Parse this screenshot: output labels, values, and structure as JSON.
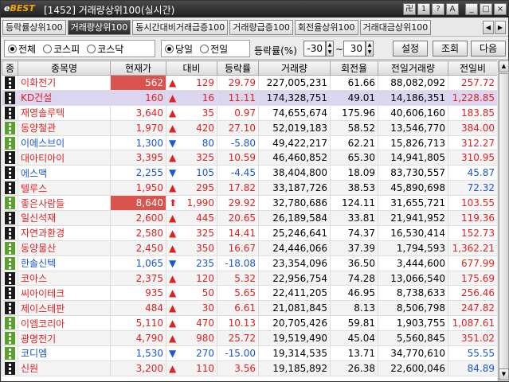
{
  "window": {
    "logo_prefix": "e",
    "logo_text": "BEST",
    "title": "[1452] 거래량상위100(실시간)",
    "title_buttons": [
      "卍",
      "1",
      "?",
      "A",
      "_",
      "□",
      "×"
    ]
  },
  "tabs": [
    {
      "label": "등락률상위100",
      "active": false
    },
    {
      "label": "거래량상위100",
      "active": true
    },
    {
      "label": "동시간대비거래급증100",
      "active": false
    },
    {
      "label": "거래량급증100",
      "active": false
    },
    {
      "label": "회전율상위100",
      "active": false
    },
    {
      "label": "거래대금상위100",
      "active": false
    }
  ],
  "filters": {
    "market": [
      {
        "label": "전체",
        "checked": true
      },
      {
        "label": "코스피",
        "checked": false
      },
      {
        "label": "코스닥",
        "checked": false
      }
    ],
    "day": [
      {
        "label": "당일",
        "checked": true
      },
      {
        "label": "전일",
        "checked": false
      }
    ],
    "range_label": "등락률(%)",
    "range_from": "-30",
    "range_sep": "~",
    "range_to": "30"
  },
  "buttons": {
    "settings": "설정",
    "query": "조회",
    "next": "다음"
  },
  "columns": [
    "종",
    "종목명",
    "현재가",
    "대비",
    "등락률",
    "거래량",
    "회전율",
    "전일거래량",
    "전일비"
  ],
  "colors": {
    "up": "#e02020",
    "down": "#1a56d6",
    "highlight": "#d9534f",
    "selected": "#dcd5f0",
    "badge_black": "#1a1a1a",
    "badge_green": "#5aa02c"
  },
  "rows": [
    {
      "badge": "black",
      "name": "이화전기",
      "price": "562",
      "dir": "up",
      "change": "129",
      "rate": "29.79",
      "volume": "227,005,231",
      "turnover": "61.66",
      "prev_volume": "88,082,092",
      "prev_ratio": "257.72",
      "price_hl": true
    },
    {
      "badge": "black",
      "name": "KD건설",
      "price": "160",
      "dir": "up",
      "change": "16",
      "rate": "11.11",
      "volume": "174,328,751",
      "turnover": "49.01",
      "prev_volume": "14,186,351",
      "prev_ratio": "1,228.85",
      "selected": true
    },
    {
      "badge": "black",
      "name": "재영솔루텍",
      "price": "3,640",
      "dir": "up",
      "change": "35",
      "rate": "0.97",
      "volume": "74,655,674",
      "turnover": "175.96",
      "prev_volume": "40,606,160",
      "prev_ratio": "183.85"
    },
    {
      "badge": "green",
      "name": "동양철관",
      "price": "1,970",
      "dir": "up",
      "change": "420",
      "rate": "27.10",
      "volume": "52,019,183",
      "turnover": "58.52",
      "prev_volume": "13,546,770",
      "prev_ratio": "384.00"
    },
    {
      "badge": "green",
      "name": "이에스브이",
      "price": "1,300",
      "dir": "down",
      "change": "80",
      "rate": "-5.80",
      "volume": "49,422,217",
      "turnover": "62.21",
      "prev_volume": "15,826,713",
      "prev_ratio": "312.27"
    },
    {
      "badge": "black",
      "name": "대아티아이",
      "price": "3,395",
      "dir": "up",
      "change": "325",
      "rate": "10.59",
      "volume": "46,460,852",
      "turnover": "65.30",
      "prev_volume": "14,941,805",
      "prev_ratio": "310.95"
    },
    {
      "badge": "black",
      "name": "에스맥",
      "price": "2,255",
      "dir": "down",
      "change": "105",
      "rate": "-4.45",
      "volume": "38,404,800",
      "turnover": "18.09",
      "prev_volume": "83,730,557",
      "prev_ratio": "45.87"
    },
    {
      "badge": "black",
      "name": "텔루스",
      "price": "1,950",
      "dir": "up",
      "change": "295",
      "rate": "17.82",
      "volume": "33,187,726",
      "turnover": "38.53",
      "prev_volume": "45,890,698",
      "prev_ratio": "72.32"
    },
    {
      "badge": "green",
      "name": "좋은사람들",
      "price": "8,640",
      "dir": "upup",
      "change": "1,990",
      "rate": "29.92",
      "volume": "32,780,686",
      "turnover": "124.11",
      "prev_volume": "31,655,721",
      "prev_ratio": "103.55",
      "price_hl": true
    },
    {
      "badge": "black",
      "name": "일신석재",
      "price": "2,600",
      "dir": "up",
      "change": "445",
      "rate": "20.65",
      "volume": "26,189,584",
      "turnover": "33.81",
      "prev_volume": "21,941,952",
      "prev_ratio": "119.36"
    },
    {
      "badge": "black",
      "name": "자연과환경",
      "price": "2,580",
      "dir": "up",
      "change": "325",
      "rate": "14.41",
      "volume": "25,246,641",
      "turnover": "74.37",
      "prev_volume": "16,530,414",
      "prev_ratio": "152.73"
    },
    {
      "badge": "green",
      "name": "동양물산",
      "price": "2,450",
      "dir": "up",
      "change": "350",
      "rate": "16.67",
      "volume": "24,446,066",
      "turnover": "37.39",
      "prev_volume": "1,794,593",
      "prev_ratio": "1,362.21"
    },
    {
      "badge": "green",
      "name": "한솔신텍",
      "price": "1,065",
      "dir": "down",
      "change": "235",
      "rate": "-18.08",
      "volume": "23,354,096",
      "turnover": "36.50",
      "prev_volume": "3,444,600",
      "prev_ratio": "677.99"
    },
    {
      "badge": "black",
      "name": "코아스",
      "price": "2,375",
      "dir": "up",
      "change": "120",
      "rate": "5.32",
      "volume": "22,956,754",
      "turnover": "74.28",
      "prev_volume": "13,066,540",
      "prev_ratio": "175.69"
    },
    {
      "badge": "black",
      "name": "씨아이테크",
      "price": "935",
      "dir": "up",
      "change": "50",
      "rate": "5.65",
      "volume": "22,411,205",
      "turnover": "46.95",
      "prev_volume": "8,738,633",
      "prev_ratio": "256.46"
    },
    {
      "badge": "black",
      "name": "제이스테판",
      "price": "484",
      "dir": "up",
      "change": "30",
      "rate": "6.61",
      "volume": "21,081,845",
      "turnover": "8.13",
      "prev_volume": "8,506,798",
      "prev_ratio": "247.82"
    },
    {
      "badge": "green",
      "name": "이엠코리아",
      "price": "5,110",
      "dir": "up",
      "change": "470",
      "rate": "10.13",
      "volume": "20,705,426",
      "turnover": "59.81",
      "prev_volume": "1,903,755",
      "prev_ratio": "1,087.61"
    },
    {
      "badge": "green",
      "name": "광명전기",
      "price": "4,790",
      "dir": "up",
      "change": "980",
      "rate": "25.72",
      "volume": "19,519,490",
      "turnover": "45.04",
      "prev_volume": "5,560,845",
      "prev_ratio": "351.02"
    },
    {
      "badge": "green",
      "name": "코디엠",
      "price": "1,530",
      "dir": "down",
      "change": "270",
      "rate": "-15.00",
      "volume": "19,314,535",
      "turnover": "13.71",
      "prev_volume": "34,770,610",
      "prev_ratio": "55.55"
    },
    {
      "badge": "black",
      "name": "신원",
      "price": "3,200",
      "dir": "up",
      "change": "110",
      "rate": "3.56",
      "volume": "19,185,892",
      "turnover": "26.38",
      "prev_volume": "22,600,046",
      "prev_ratio": "84.89"
    }
  ],
  "scrollbar": {
    "up": "▲",
    "down": "▼"
  }
}
